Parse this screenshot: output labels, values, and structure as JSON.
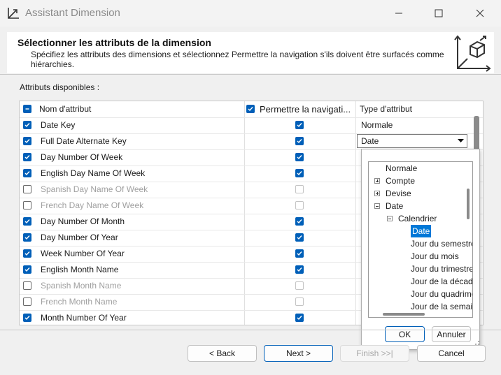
{
  "window": {
    "title": "Assistant Dimension"
  },
  "header": {
    "title": "Sélectionner les attributs de la dimension",
    "description": "Spécifiez les attributs des dimensions et sélectionnez Permettre la navigation s'ils doivent être surfacés comme hiérarchies."
  },
  "available_label": "Attributs disponibles :",
  "grid": {
    "headers": {
      "name": "Nom d'attribut",
      "browse": "Permettre la navigati...",
      "type": "Type d'attribut"
    },
    "rows": [
      {
        "name": "Date Key",
        "checked": true,
        "browse": true,
        "enabled": true,
        "type": "Normale"
      },
      {
        "name": "Full Date Alternate Key",
        "checked": true,
        "browse": true,
        "enabled": true,
        "type": "Date"
      },
      {
        "name": "Day Number Of Week",
        "checked": true,
        "browse": true,
        "enabled": true,
        "type": ""
      },
      {
        "name": "English Day Name Of Week",
        "checked": true,
        "browse": true,
        "enabled": true,
        "type": ""
      },
      {
        "name": "Spanish Day Name Of Week",
        "checked": false,
        "browse": false,
        "enabled": false,
        "type": ""
      },
      {
        "name": "French Day Name Of Week",
        "checked": false,
        "browse": false,
        "enabled": false,
        "type": ""
      },
      {
        "name": "Day Number Of Month",
        "checked": true,
        "browse": true,
        "enabled": true,
        "type": ""
      },
      {
        "name": "Day Number Of Year",
        "checked": true,
        "browse": true,
        "enabled": true,
        "type": ""
      },
      {
        "name": "Week Number Of Year",
        "checked": true,
        "browse": true,
        "enabled": true,
        "type": ""
      },
      {
        "name": "English Month Name",
        "checked": true,
        "browse": true,
        "enabled": true,
        "type": ""
      },
      {
        "name": "Spanish Month Name",
        "checked": false,
        "browse": false,
        "enabled": false,
        "type": ""
      },
      {
        "name": "French Month Name",
        "checked": false,
        "browse": false,
        "enabled": false,
        "type": ""
      },
      {
        "name": "Month Number Of Year",
        "checked": true,
        "browse": true,
        "enabled": true,
        "type": ""
      }
    ]
  },
  "dropdown": {
    "items": [
      {
        "label": "Normale",
        "depth": 0,
        "expander": "none",
        "selected": false
      },
      {
        "label": "Compte",
        "depth": 0,
        "expander": "plus",
        "selected": false
      },
      {
        "label": "Devise",
        "depth": 0,
        "expander": "plus",
        "selected": false
      },
      {
        "label": "Date",
        "depth": 0,
        "expander": "minus",
        "selected": false
      },
      {
        "label": "Calendrier",
        "depth": 1,
        "expander": "minus",
        "selected": false
      },
      {
        "label": "Date",
        "depth": 2,
        "expander": "none",
        "selected": true
      },
      {
        "label": "Jour du semestre",
        "depth": 2,
        "expander": "none",
        "selected": false
      },
      {
        "label": "Jour du mois",
        "depth": 2,
        "expander": "none",
        "selected": false
      },
      {
        "label": "Jour du trimestre",
        "depth": 2,
        "expander": "none",
        "selected": false
      },
      {
        "label": "Jour de la décade",
        "depth": 2,
        "expander": "none",
        "selected": false
      },
      {
        "label": "Jour du quadrimestre",
        "depth": 2,
        "expander": "none",
        "selected": false
      },
      {
        "label": "Jour de la semaine",
        "depth": 2,
        "expander": "none",
        "selected": false
      }
    ],
    "ok_label": "OK",
    "cancel_label": "Annuler"
  },
  "footer": {
    "back_label": "< Back",
    "next_label": "Next >",
    "finish_label": "Finish >>|",
    "cancel_label": "Cancel"
  },
  "colors": {
    "accent": "#005fb8",
    "selection": "#0078d7"
  }
}
